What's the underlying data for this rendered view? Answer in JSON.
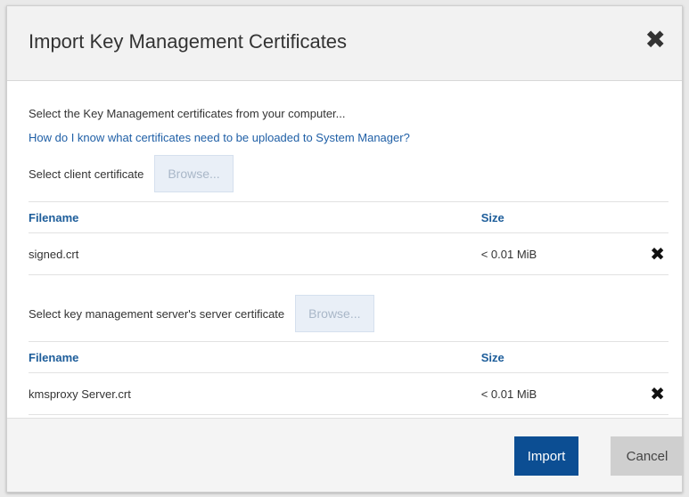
{
  "dialog": {
    "title": "Import Key Management Certificates",
    "close_label": "✖",
    "intro": "Select the Key Management certificates from your computer...",
    "help_link": "How do I know what certificates need to be uploaded to System Manager?"
  },
  "client_cert": {
    "label": "Select client certificate",
    "browse_label": "Browse...",
    "headers": {
      "filename": "Filename",
      "size": "Size"
    },
    "rows": [
      {
        "filename": "signed.crt",
        "size": "< 0.01 MiB"
      }
    ]
  },
  "server_cert": {
    "label": "Select key management server's server certificate",
    "browse_label": "Browse...",
    "headers": {
      "filename": "Filename",
      "size": "Size"
    },
    "rows": [
      {
        "filename": "kmsproxy Server.crt",
        "size": "< 0.01 MiB"
      }
    ]
  },
  "footer": {
    "import_label": "Import",
    "cancel_label": "Cancel"
  },
  "colors": {
    "primary": "#0c4e93",
    "link": "#1f5fa6",
    "header_text": "#1d5d9a"
  }
}
